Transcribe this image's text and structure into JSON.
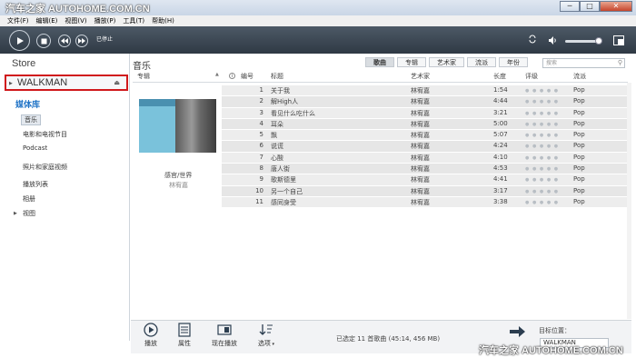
{
  "watermark": {
    "top": "汽车之家 AUTOHOME.COM.CN",
    "bottom": "汽车之家 AUTOHOME.COM.CN"
  },
  "window": {
    "minimize": "─",
    "maximize": "□",
    "close": "✕"
  },
  "menu": [
    "文件(F)",
    "编辑(E)",
    "视图(V)",
    "播放(P)",
    "工具(T)",
    "帮助(H)"
  ],
  "player": {
    "status": "已停止"
  },
  "sidebar": {
    "store": "Store",
    "device": "WALKMAN",
    "library_title": "媒体库",
    "items": [
      "音乐",
      "电影和电视节目",
      "Podcast",
      "照片和家庭视频",
      "播放列表",
      "相册",
      "视图"
    ]
  },
  "main": {
    "title": "音乐",
    "tabs": [
      "歌曲",
      "专辑",
      "艺术家",
      "流派",
      "年份"
    ],
    "search_placeholder": "搜索",
    "columns": {
      "album": "专辑",
      "info": "i",
      "num": "编号",
      "title": "标题",
      "artist": "艺术家",
      "length": "长度",
      "rating": "评级",
      "genre": "流派"
    },
    "album": {
      "name": "感官/世界",
      "artist": "林宥嘉"
    },
    "songs": [
      {
        "num": "1",
        "title": "关于我",
        "artist": "林宥嘉",
        "length": "1:54",
        "genre": "Pop"
      },
      {
        "num": "2",
        "title": "解High人",
        "artist": "林宥嘉",
        "length": "4:44",
        "genre": "Pop"
      },
      {
        "num": "3",
        "title": "看见什么吃什么",
        "artist": "林宥嘉",
        "length": "3:21",
        "genre": "Pop"
      },
      {
        "num": "4",
        "title": "耳朵",
        "artist": "林宥嘉",
        "length": "5:00",
        "genre": "Pop"
      },
      {
        "num": "5",
        "title": "飘",
        "artist": "林宥嘉",
        "length": "5:07",
        "genre": "Pop"
      },
      {
        "num": "6",
        "title": "说谎",
        "artist": "林宥嘉",
        "length": "4:24",
        "genre": "Pop"
      },
      {
        "num": "7",
        "title": "心酸",
        "artist": "林宥嘉",
        "length": "4:10",
        "genre": "Pop"
      },
      {
        "num": "8",
        "title": "唐人街",
        "artist": "林宥嘉",
        "length": "4:53",
        "genre": "Pop"
      },
      {
        "num": "9",
        "title": "歌斯德里",
        "artist": "林宥嘉",
        "length": "4:41",
        "genre": "Pop"
      },
      {
        "num": "10",
        "title": "另一个自己",
        "artist": "林宥嘉",
        "length": "3:17",
        "genre": "Pop"
      },
      {
        "num": "11",
        "title": "感同身受",
        "artist": "林宥嘉",
        "length": "3:38",
        "genre": "Pop"
      }
    ]
  },
  "bottom": {
    "buttons": [
      "播放",
      "属性",
      "现在播放",
      "选项"
    ],
    "selection_info": "已选定 11 首歌曲 (45:14, 456 MB)",
    "target_label": "目标位置：",
    "target_value": "WALKMAN"
  },
  "colors": {
    "accent": "#1f73c6",
    "highlight": "#d0181c",
    "player_bg": "#2f3944"
  }
}
